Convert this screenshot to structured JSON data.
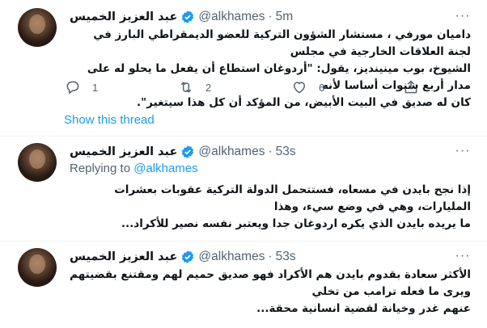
{
  "tweets": [
    {
      "name": "عبد العزيز الخميس",
      "handle": "@alkhames",
      "dot": "·",
      "time": "5m",
      "text_lines": [
        "داميان مورفي ، مستشار الشؤون التركية للعضو الديمقراطي البارز في لجنة العلاقات الخارجية في مجلس",
        "الشيوخ، بوب مينينديز، يقول: \"أردوغان استطاع أن يفعل ما يحلو له على مدار أربع سنوات أساسا لأنه",
        "كان له صديق في البيت الأبيض، من المؤكد أن كل هذا سيتغير\"."
      ],
      "reply_count": "1",
      "retweet_count": "2",
      "like_count": "6"
    },
    {
      "name": "عبد العزيز الخميس",
      "handle": "@alkhames",
      "dot": "·",
      "time": "53s",
      "replying_prefix": "Replying to",
      "replying_to": "@alkhames",
      "text_lines": [
        "إذا نجح بايدن في مسعاه، فستتحمل الدولة التركية عقوبات بعشرات المليارات، وهي في وضع سيء، وهذا",
        "ما يريده بايدن الذي يكره اردوغان جدا ويعتبر نفسه نصير للأكراد..."
      ]
    },
    {
      "name": "عبد العزيز الخميس",
      "handle": "@alkhames",
      "dot": "·",
      "time": "53s",
      "text_lines": [
        "الأكثر سعادة بقدوم بايدن هم الأكراد فهو صديق حميم لهم ومقتنع بقضيتهم ويرى ما فعله ترامب من تخلي",
        "عنهم غدر وخيانة لقضية انسانية محقة..."
      ]
    }
  ],
  "show_thread": "Show this thread",
  "more_glyph": "···",
  "colors": {
    "accent": "#1d9bf0",
    "muted": "#536471",
    "text": "#0f1419"
  },
  "icons": [
    "verified-badge-icon",
    "reply-icon",
    "retweet-icon",
    "like-icon",
    "share-icon",
    "more-icon"
  ]
}
